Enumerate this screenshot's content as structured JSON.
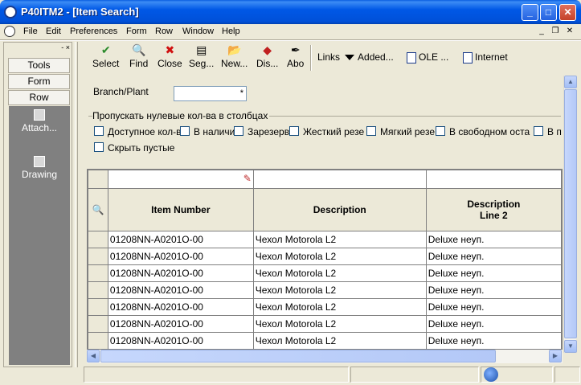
{
  "window": {
    "title": "P40ITM2 - [Item Search]",
    "minimize": "_",
    "maximize": "□",
    "close": "✕"
  },
  "menu": {
    "items": [
      {
        "label": "File"
      },
      {
        "label": "Edit"
      },
      {
        "label": "Preferences"
      },
      {
        "label": "Form"
      },
      {
        "label": "Row"
      },
      {
        "label": "Window"
      },
      {
        "label": "Help"
      }
    ],
    "mdi_min": "_",
    "mdi_restore": "❐",
    "mdi_close": "✕"
  },
  "left_pane": {
    "close_glyphs": "- ×",
    "buttons": [
      {
        "label": "Tools"
      },
      {
        "label": "Form"
      },
      {
        "label": "Row"
      }
    ],
    "items": [
      {
        "label": "Attach...",
        "icon": "attachment-icon"
      },
      {
        "label": "Drawing",
        "icon": "drawing-icon"
      }
    ]
  },
  "toolbar": {
    "buttons": [
      {
        "label": "Select",
        "icon": "✔",
        "color": "#2a8a2a"
      },
      {
        "label": "Find",
        "icon": "🔍",
        "color": "#000000"
      },
      {
        "label": "Close",
        "icon": "✖",
        "color": "#d01010"
      },
      {
        "label": "Seg...",
        "icon": "▤",
        "color": "#000000"
      },
      {
        "label": "New...",
        "icon": "📂",
        "color": "#000000"
      },
      {
        "label": "Dis...",
        "icon": "◆",
        "color": "#c02020"
      },
      {
        "label": "Abo",
        "icon": "✒",
        "color": "#000000"
      }
    ],
    "links_label": "Links",
    "added_label": "Added...",
    "ole_label": "OLE ...",
    "internet_label": "Internet"
  },
  "form": {
    "branch_label": "Branch/Plant",
    "branch_value": "*",
    "group_title": "Пропускать нулевые кол-ва в столбцах",
    "checkboxes": [
      {
        "label": "Доступное кол-в",
        "checked": false
      },
      {
        "label": "В наличи",
        "checked": false
      },
      {
        "label": "Зарезерв",
        "checked": false
      },
      {
        "label": "Жесткий резе",
        "checked": false
      },
      {
        "label": "Мягкий резе",
        "checked": false
      },
      {
        "label": "В свободном оста",
        "checked": false
      },
      {
        "label": "В п",
        "checked": false
      },
      {
        "label": "Скрыть пустые",
        "checked": false
      }
    ]
  },
  "grid": {
    "columns": [
      {
        "header": "",
        "icon": "qbe-icon"
      },
      {
        "header": "Item Number"
      },
      {
        "header": "Description"
      },
      {
        "header": "Description\nLine 2"
      }
    ],
    "rows": [
      [
        "01208NN-A0201O-00",
        "Чехол Motorola L2",
        "Deluxe неуп."
      ],
      [
        "01208NN-A0201O-00",
        "Чехол Motorola L2",
        "Deluxe неуп."
      ],
      [
        "01208NN-A0201O-00",
        "Чехол Motorola L2",
        "Deluxe неуп."
      ],
      [
        "01208NN-A0201O-00",
        "Чехол Motorola L2",
        "Deluxe неуп."
      ],
      [
        "01208NN-A0201O-00",
        "Чехол Motorola L2",
        "Deluxe неуп."
      ],
      [
        "01208NN-A0201O-00",
        "Чехол Motorola L2",
        "Deluxe неуп."
      ],
      [
        "01208NN-A0201O-00",
        "Чехол Motorola L2",
        "Deluxe неуп."
      ]
    ]
  },
  "colors": {
    "titlebar": "#0058e6",
    "chrome": "#ece9d8",
    "left_list": "#808080"
  }
}
